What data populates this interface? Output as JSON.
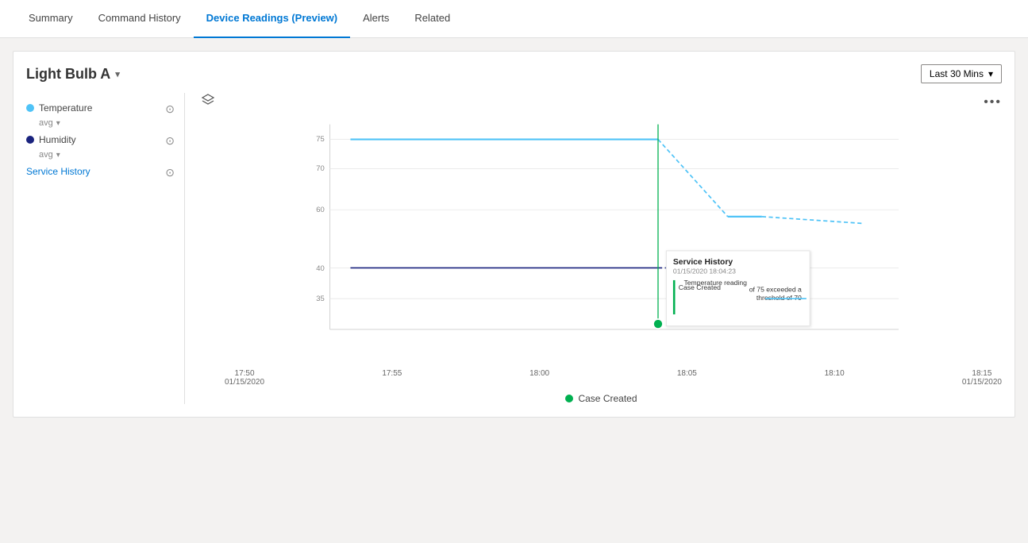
{
  "nav": {
    "items": [
      {
        "label": "Summary",
        "active": false
      },
      {
        "label": "Command History",
        "active": false
      },
      {
        "label": "Device Readings (Preview)",
        "active": true
      },
      {
        "label": "Alerts",
        "active": false
      },
      {
        "label": "Related",
        "active": false
      }
    ]
  },
  "card": {
    "device_title": "Light Bulb A",
    "time_range_label": "Last 30 Mins",
    "legend": [
      {
        "label": "Temperature",
        "sublabel": "avg",
        "dot_color": "#4fc3f7",
        "type": "temperature"
      },
      {
        "label": "Humidity",
        "sublabel": "avg",
        "dot_color": "#1a237e",
        "type": "humidity"
      },
      {
        "label": "Service History",
        "dot_color": null,
        "type": "service_history",
        "link": true
      }
    ],
    "x_axis_labels": [
      {
        "time": "17:50",
        "date": "01/15/2020"
      },
      {
        "time": "17:55",
        "date": ""
      },
      {
        "time": "18:00",
        "date": ""
      },
      {
        "time": "18:05",
        "date": ""
      },
      {
        "time": "18:10",
        "date": ""
      },
      {
        "time": "18:15",
        "date": "01/15/2020"
      }
    ],
    "y_axis_labels": [
      "75",
      "70",
      "60",
      "40",
      "35"
    ],
    "tooltip": {
      "title": "Service History",
      "date": "01/15/2020 18:04:23",
      "event": "Case Created",
      "description": "Temperature reading of 75 exceeded a threshold of 70"
    },
    "legend_bottom_label": "Case Created",
    "more_icon": "•••",
    "layers_icon": "⊕"
  }
}
